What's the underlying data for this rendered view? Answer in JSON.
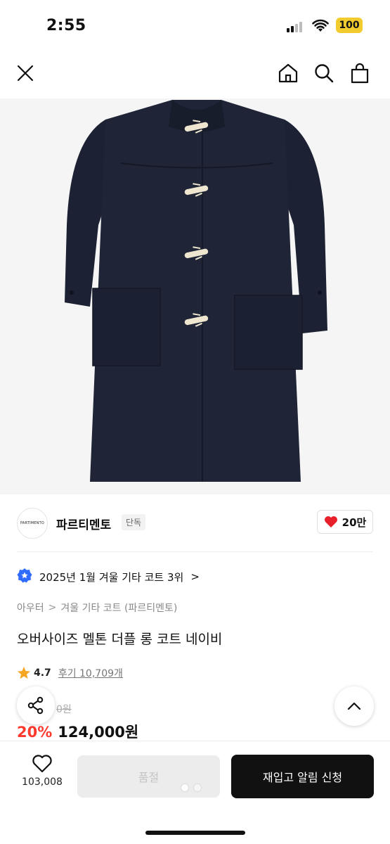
{
  "status_bar": {
    "time": "2:55",
    "battery": "100",
    "battery_color": "#f2cc2e"
  },
  "nav": {
    "icons": [
      "close-icon",
      "home-icon",
      "search-icon",
      "shopping-bag-icon"
    ]
  },
  "product_image": {
    "alt": "navy duffle coat with toggle buttons"
  },
  "brand": {
    "logo_text": "PARTIMENTO",
    "name": "파르티멘토",
    "exclusive_tag": "단독",
    "likes": "20만",
    "like_color": "#e8202b"
  },
  "ranking": {
    "text": "2025년 1월 겨울 기타 코트 3위",
    "chevron": ">"
  },
  "breadcrumb": {
    "category": "아우터",
    "separator": ">",
    "subcategory": "겨울 기타 코트 (파르티멘토)"
  },
  "product": {
    "title": "오버사이즈 멜톤 더플 롱 코트 네이비"
  },
  "rating": {
    "value": "4.7",
    "reviews": "후기 10,709개",
    "star_color": "#f5a623"
  },
  "price": {
    "original": "0원",
    "discount": "20%",
    "sale": "124,000원",
    "discount_color": "#ff3b30"
  },
  "bottom_bar": {
    "wish_count": "103,008",
    "soldout_label": "품절",
    "restock_label": "재입고 알림 신청"
  }
}
